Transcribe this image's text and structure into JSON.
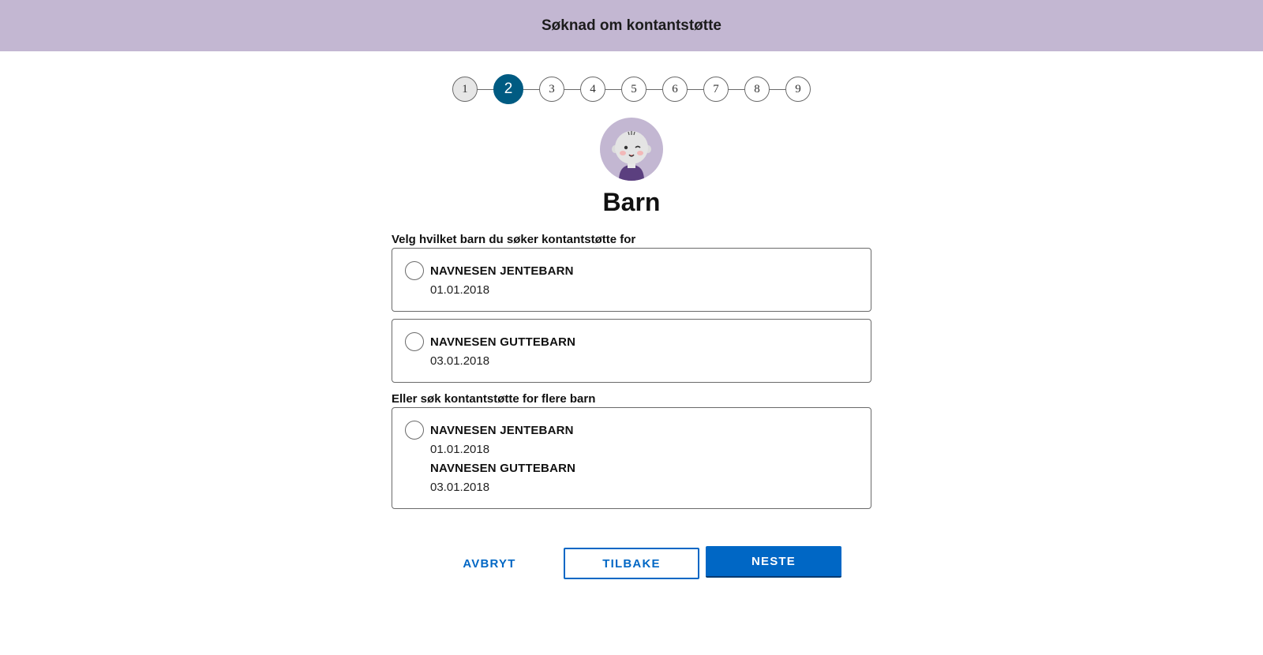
{
  "header": {
    "title": "Søknad om kontantstøtte"
  },
  "stepper": {
    "steps": [
      "1",
      "2",
      "3",
      "4",
      "5",
      "6",
      "7",
      "8",
      "9"
    ],
    "current_step": 2
  },
  "avatar": {
    "icon": "baby-avatar-icon"
  },
  "page": {
    "title": "Barn"
  },
  "single_choice": {
    "label": "Velg hvilket barn du søker kontantstøtte for",
    "options": [
      {
        "name": "NAVNESEN JENTEBARN",
        "date": "01.01.2018"
      },
      {
        "name": "NAVNESEN GUTTEBARN",
        "date": "03.01.2018"
      }
    ]
  },
  "multi_choice": {
    "label": "Eller søk kontantstøtte for flere barn",
    "children": [
      {
        "name": "NAVNESEN JENTEBARN",
        "date": "01.01.2018"
      },
      {
        "name": "NAVNESEN GUTTEBARN",
        "date": "03.01.2018"
      }
    ]
  },
  "buttons": {
    "cancel": "AVBRYT",
    "back": "TILBAKE",
    "next": "NESTE"
  },
  "colors": {
    "header_bg": "#c3b7d2",
    "step_active": "#005b82",
    "primary": "#0067c5"
  }
}
